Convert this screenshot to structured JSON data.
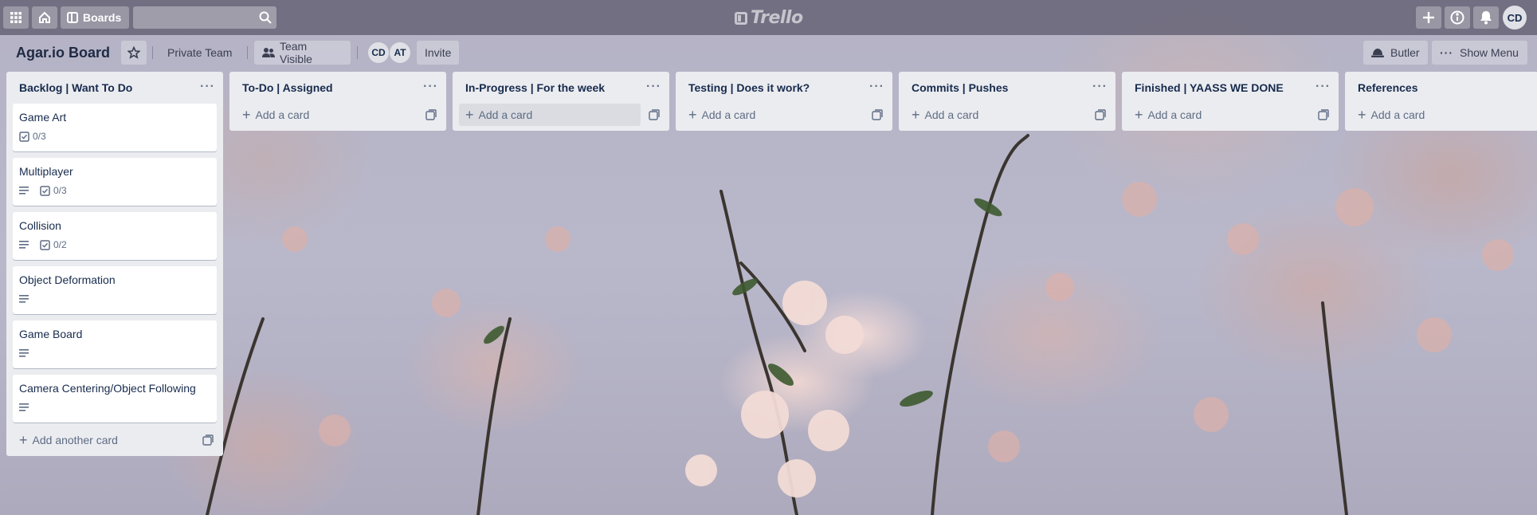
{
  "topbar": {
    "boards_label": "Boards",
    "search_value": "",
    "logo_text": "Trello",
    "avatar_initials": "CD"
  },
  "board": {
    "title": "Agar.io Board",
    "private_team": "Private Team",
    "team_visible": "Team Visible",
    "members": [
      "CD",
      "AT"
    ],
    "invite": "Invite",
    "butler": "Butler",
    "show_menu": "Show Menu"
  },
  "lists": [
    {
      "title": "Backlog | Want To Do",
      "add_label": "Add another card",
      "cards": [
        {
          "title": "Game Art",
          "description": false,
          "checklist": "0/3"
        },
        {
          "title": "Multiplayer",
          "description": true,
          "checklist": "0/3"
        },
        {
          "title": "Collision",
          "description": true,
          "checklist": "0/2"
        },
        {
          "title": "Object Deformation",
          "description": true,
          "checklist": ""
        },
        {
          "title": "Game Board",
          "description": true,
          "checklist": ""
        },
        {
          "title": "Camera Centering/Object Following",
          "description": true,
          "checklist": ""
        }
      ]
    },
    {
      "title": "To-Do | Assigned",
      "add_label": "Add a card",
      "cards": []
    },
    {
      "title": "In-Progress | For the week",
      "add_label": "Add a card",
      "cards": []
    },
    {
      "title": "Testing | Does it work?",
      "add_label": "Add a card",
      "cards": []
    },
    {
      "title": "Commits | Pushes",
      "add_label": "Add a card",
      "cards": []
    },
    {
      "title": "Finished | YAASS WE DONE",
      "add_label": "Add a card",
      "cards": []
    },
    {
      "title": "References",
      "add_label": "Add a card",
      "cards": []
    }
  ],
  "colors": {
    "topbar": "#5f5c70",
    "list_bg": "#ebecf0",
    "card_bg": "#ffffff",
    "text": "#172b4d",
    "muted": "#5e6c84"
  }
}
